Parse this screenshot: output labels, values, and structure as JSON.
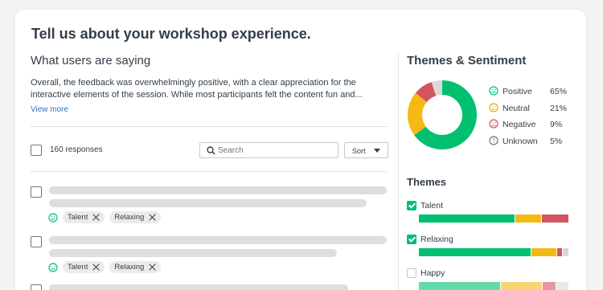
{
  "page": {
    "title": "Tell us about your workshop experience."
  },
  "summary": {
    "heading": "What users are saying",
    "text_line1": "Overall, the feedback was overwhelmingly positive, with a clear appreciation for the",
    "text_line2": "interactive elements of the session. While most participants felt the content fun and...",
    "view_more": "View more"
  },
  "toolbar": {
    "responses_label": "160 responses",
    "search_placeholder": "Search",
    "sort_label": "Sort"
  },
  "responses": [
    {
      "tags": [
        "Talent",
        "Relaxing"
      ],
      "sentiment_icon": "smiley-icon"
    },
    {
      "tags": [
        "Talent",
        "Relaxing"
      ],
      "sentiment_icon": "smiley-icon"
    }
  ],
  "sentiment": {
    "heading": "Themes & Sentiment",
    "items": [
      {
        "name": "Positive",
        "pct": "65%",
        "value": 65,
        "color": "#00bf6f",
        "icon": "positive-smiley-icon"
      },
      {
        "name": "Neutral",
        "pct": "21%",
        "value": 21,
        "color": "#f5b914",
        "icon": "neutral-face-icon"
      },
      {
        "name": "Negative",
        "pct": "9%",
        "value": 9,
        "color": "#d2555f",
        "icon": "negative-face-icon"
      },
      {
        "name": "Unknown",
        "pct": "5%",
        "value": 5,
        "color": "#d9d9d9",
        "icon": "question-icon"
      }
    ]
  },
  "themes": {
    "heading": "Themes",
    "items": [
      {
        "name": "Talent",
        "checked": true,
        "muted": false,
        "segments": [
          64,
          17,
          18,
          0
        ]
      },
      {
        "name": "Relaxing",
        "checked": true,
        "muted": false,
        "segments": [
          75,
          17,
          3,
          4
        ]
      },
      {
        "name": "Happy",
        "checked": false,
        "muted": true,
        "segments": [
          55,
          28,
          9,
          8
        ]
      }
    ]
  },
  "colors": {
    "positive": "#00bf6f",
    "neutral": "#f5b914",
    "negative": "#d2555f",
    "unknown": "#d9d9d9",
    "link": "#2e78b9"
  }
}
